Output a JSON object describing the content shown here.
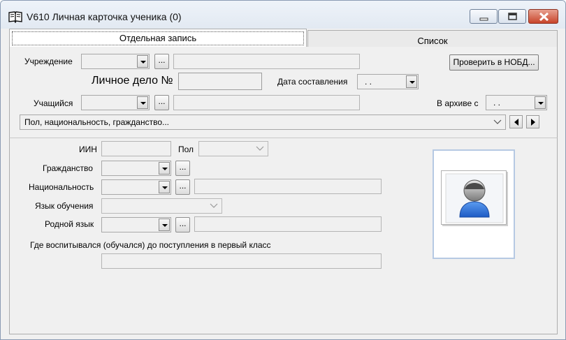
{
  "window": {
    "title": "V610 Личная карточка ученика (0)"
  },
  "tabs": [
    {
      "label": "Отдельная запись",
      "active": true
    },
    {
      "label": "Список",
      "active": false
    }
  ],
  "top": {
    "institution_label": "Учреждение",
    "institution_value": "",
    "institution_name": "",
    "check_button": "Проверить в НОБД...",
    "file_label": "Личное дело №",
    "file_value": "",
    "date_label": "Дата составления",
    "date_value": ". .",
    "student_label": "Учащийся",
    "student_value": "",
    "student_name": "",
    "archive_label": "В архиве с",
    "archive_value": ". .",
    "section_value": "Пол, национальность, гражданство..."
  },
  "details": {
    "iin_label": "ИИН",
    "iin_value": "",
    "gender_label": "Пол",
    "gender_value": "",
    "citizenship_label": "Гражданство",
    "citizenship_value": "",
    "nationality_label": "Национальность",
    "nationality_value": "",
    "nationality_text": "",
    "language_label": "Язык обучения",
    "language_value": "",
    "native_label": "Родной язык",
    "native_value": "",
    "native_text": "",
    "upbringing_label": "Где воспитывался (обучался) до поступления в первый класс",
    "upbringing_value": ""
  },
  "buttons": {
    "ellipsis": "..."
  },
  "icons": {
    "app": "book-icon",
    "minimize": "minimize-icon",
    "maximize": "maximize-icon",
    "close": "close-icon",
    "prev": "arrow-left-icon",
    "next": "arrow-right-icon",
    "photo": "user-avatar-icon"
  },
  "colors": {
    "close_button": "#c8452b",
    "photo_border": "#b6c9e3",
    "avatar_body": "#2b6fd6"
  }
}
